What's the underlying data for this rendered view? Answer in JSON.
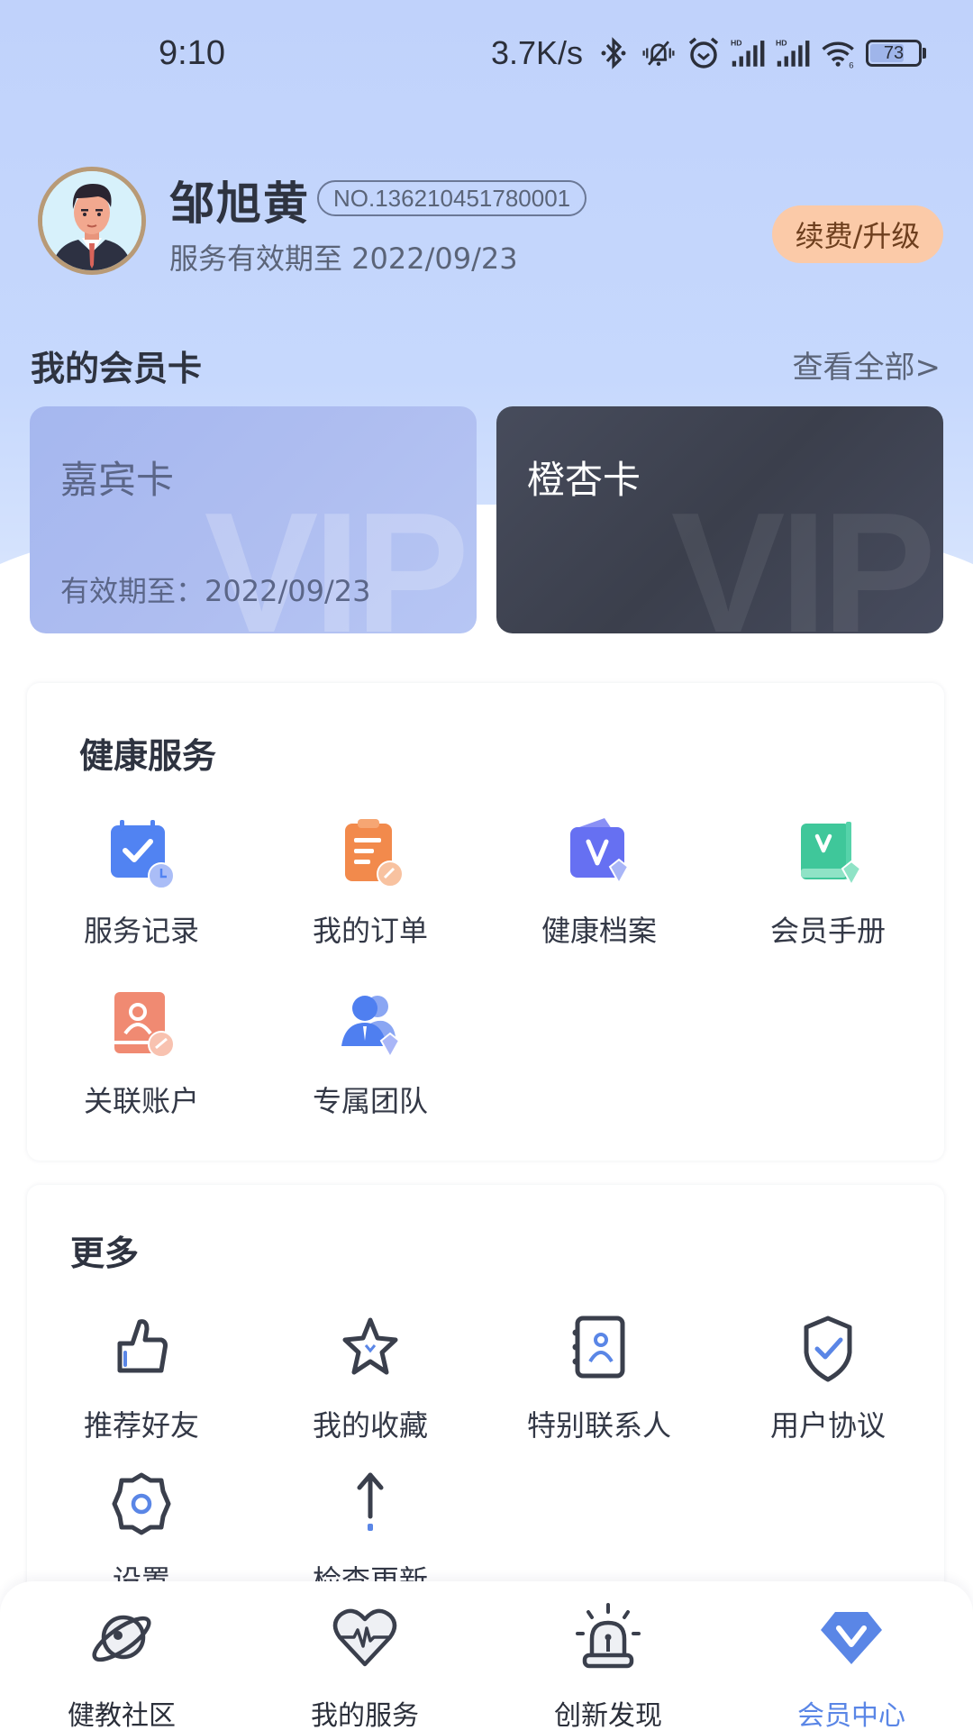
{
  "status_bar": {
    "time": "9:10",
    "net_speed": "3.7K/s",
    "battery_level": "73",
    "battery_fraction": 0.73,
    "icons": [
      "bluetooth-icon",
      "vibrate-off-icon",
      "alarm-icon",
      "hd-signal-icon",
      "hd-signal-icon",
      "wifi-icon",
      "battery-icon"
    ]
  },
  "profile": {
    "name": "邹旭黄",
    "member_no": "NO.136210451780001",
    "valid_until": "服务有效期至 2022/09/23",
    "renew_button": "续费/升级"
  },
  "member_cards": {
    "title": "我的会员卡",
    "view_all": "查看全部>",
    "cards": [
      {
        "name": "嘉宾卡",
        "expiry": "有效期至：2022/09/23",
        "watermark": "VIP"
      },
      {
        "name": "橙杏卡",
        "expiry": "",
        "watermark": "VIP"
      }
    ]
  },
  "health_services": {
    "title": "健康服务",
    "items": [
      {
        "label": "服务记录",
        "icon": "calendar-check-icon",
        "color": "#4f7ff0"
      },
      {
        "label": "我的订单",
        "icon": "clipboard-order-icon",
        "color": "#f28a4c"
      },
      {
        "label": "健康档案",
        "icon": "health-folder-icon",
        "color": "#6670f2"
      },
      {
        "label": "会员手册",
        "icon": "member-book-icon",
        "color": "#3fc79a"
      },
      {
        "label": "关联账户",
        "icon": "linked-account-icon",
        "color": "#f08a72"
      },
      {
        "label": "专属团队",
        "icon": "team-icon",
        "color": "#4f7ff0"
      }
    ]
  },
  "more": {
    "title": "更多",
    "items": [
      {
        "label": "推荐好友",
        "icon": "thumbs-up-icon"
      },
      {
        "label": "我的收藏",
        "icon": "star-icon"
      },
      {
        "label": "特别联系人",
        "icon": "contact-book-icon"
      },
      {
        "label": "用户协议",
        "icon": "shield-check-icon"
      },
      {
        "label": "设置",
        "icon": "gear-icon"
      },
      {
        "label": "检查更新",
        "icon": "arrow-up-icon"
      }
    ]
  },
  "bottom_nav": {
    "items": [
      {
        "label": "健教社区",
        "icon": "planet-icon",
        "active": false
      },
      {
        "label": "我的服务",
        "icon": "heart-pulse-icon",
        "active": false
      },
      {
        "label": "创新发现",
        "icon": "siren-icon",
        "active": false
      },
      {
        "label": "会员中心",
        "icon": "diamond-v-icon",
        "active": true
      }
    ]
  },
  "colors": {
    "accent": "#5a86e6",
    "renew_bg": "#fbcaa8",
    "header_bg": "#c3d5fc",
    "dark_card": "#40444f"
  }
}
